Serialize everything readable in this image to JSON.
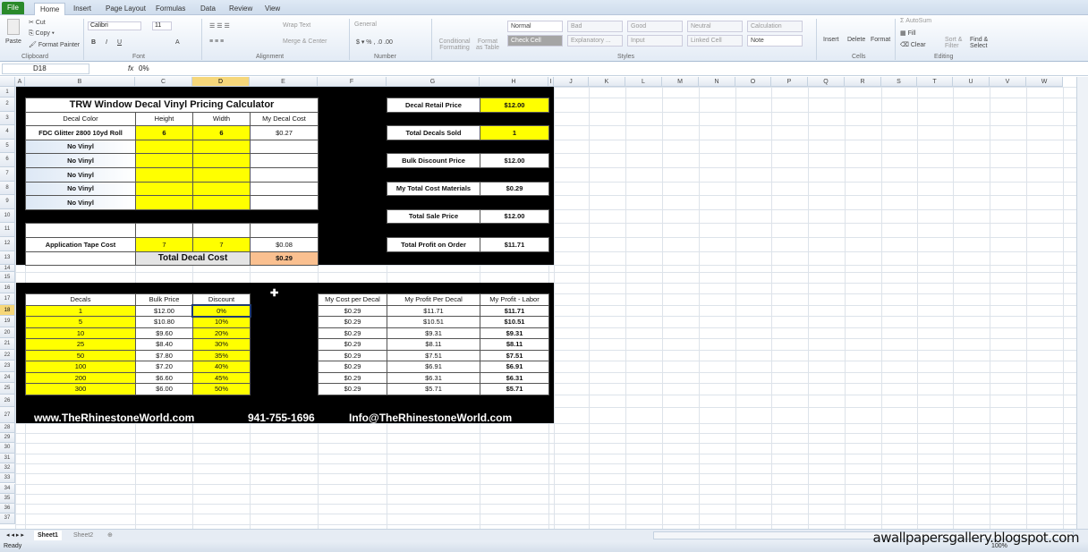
{
  "ribbon": {
    "tabs": [
      "File",
      "Home",
      "Insert",
      "Page Layout",
      "Formulas",
      "Data",
      "Review",
      "View"
    ],
    "active_tab": "Home",
    "clipboard": {
      "paste": "Paste",
      "cut": "Cut",
      "copy": "Copy",
      "format_painter": "Format Painter",
      "label": "Clipboard"
    },
    "font": {
      "name": "Calibri",
      "size": "11",
      "label": "Font"
    },
    "alignment": {
      "wrap": "Wrap Text",
      "merge": "Merge & Center",
      "label": "Alignment"
    },
    "number": {
      "format": "General",
      "label": "Number"
    },
    "styles": {
      "conditional": "Conditional Formatting",
      "format_table": "Format as Table",
      "items": [
        "Normal",
        "Bad",
        "Good",
        "Neutral",
        "Calculation",
        "Check Cell",
        "Explanatory ...",
        "Input",
        "Linked Cell",
        "Note"
      ],
      "label": "Styles"
    },
    "cells": {
      "insert": "Insert",
      "delete": "Delete",
      "format": "Format",
      "label": "Cells"
    },
    "editing": {
      "autosum": "AutoSum",
      "fill": "Fill",
      "clear": "Clear",
      "sort": "Sort & Filter",
      "find": "Find & Select",
      "label": "Editing"
    }
  },
  "formula_bar": {
    "name_box": "D18",
    "fx": "fx",
    "formula": "0%"
  },
  "columns": [
    "A",
    "B",
    "C",
    "D",
    "E",
    "F",
    "G",
    "H",
    "I",
    "J",
    "K",
    "L",
    "M",
    "N",
    "O",
    "P",
    "Q",
    "R",
    "S",
    "T",
    "U",
    "V",
    "W"
  ],
  "selected": {
    "column": "D",
    "row": 18
  },
  "calculator": {
    "title": "TRW Window Decal Vinyl Pricing Calculator",
    "headers": [
      "Decal Color",
      "Height",
      "Width",
      "My Decal Cost"
    ],
    "rows": [
      [
        "FDC Glitter 2800 10yd Roll",
        "6",
        "6",
        "$0.27"
      ],
      [
        "No Vinyl",
        "",
        "",
        ""
      ],
      [
        "No Vinyl",
        "",
        "",
        ""
      ],
      [
        "No Vinyl",
        "",
        "",
        ""
      ],
      [
        "No Vinyl",
        "",
        "",
        ""
      ],
      [
        "No Vinyl",
        "",
        "",
        ""
      ]
    ],
    "tape": [
      "Application Tape Cost",
      "7",
      "7",
      "$0.08"
    ],
    "total_label": "Total Decal Cost",
    "total_value": "$0.29"
  },
  "summary": [
    {
      "label": "Decal Retail Price",
      "value": "$12.00"
    },
    {
      "label": "Total Decals Sold",
      "value": "1"
    },
    {
      "label": "Bulk Discount Price",
      "value": "$12.00"
    },
    {
      "label": "My Total Cost Materials",
      "value": "$0.29"
    },
    {
      "label": "Total Sale Price",
      "value": "$12.00"
    },
    {
      "label": "Total Profit on Order",
      "value": "$11.71"
    }
  ],
  "bulk": {
    "headers": [
      "Decals",
      "Bulk Price",
      "Discount"
    ],
    "rows": [
      [
        "1",
        "$12.00",
        "0%"
      ],
      [
        "5",
        "$10.80",
        "10%"
      ],
      [
        "10",
        "$9.60",
        "20%"
      ],
      [
        "25",
        "$8.40",
        "30%"
      ],
      [
        "50",
        "$7.80",
        "35%"
      ],
      [
        "100",
        "$7.20",
        "40%"
      ],
      [
        "200",
        "$6.60",
        "45%"
      ],
      [
        "300",
        "$6.00",
        "50%"
      ]
    ]
  },
  "profit": {
    "headers": [
      "My Cost per Decal",
      "My Profit Per Decal",
      "My Profit - Labor"
    ],
    "rows": [
      [
        "$0.29",
        "$11.71",
        "$11.71"
      ],
      [
        "$0.29",
        "$10.51",
        "$10.51"
      ],
      [
        "$0.29",
        "$9.31",
        "$9.31"
      ],
      [
        "$0.29",
        "$8.11",
        "$8.11"
      ],
      [
        "$0.29",
        "$7.51",
        "$7.51"
      ],
      [
        "$0.29",
        "$6.91",
        "$6.91"
      ],
      [
        "$0.29",
        "$6.31",
        "$6.31"
      ],
      [
        "$0.29",
        "$5.71",
        "$5.71"
      ]
    ]
  },
  "footer": {
    "website": "www.TheRhinestoneWorld.com",
    "phone": "941-755-1696",
    "email": "Info@TheRhinestoneWorld.com"
  },
  "sheets": [
    "Sheet1",
    "Sheet2"
  ],
  "active_sheet": "Sheet1",
  "status": {
    "text": "Ready",
    "zoom": "100%"
  },
  "watermark": "awallpapersgallery.blogspot.com",
  "colors": {
    "input_yellow": "#ffff00",
    "total_orange": "#fac090",
    "file_tab": "#2a8a2a",
    "selection_header": "#f6d77a"
  }
}
